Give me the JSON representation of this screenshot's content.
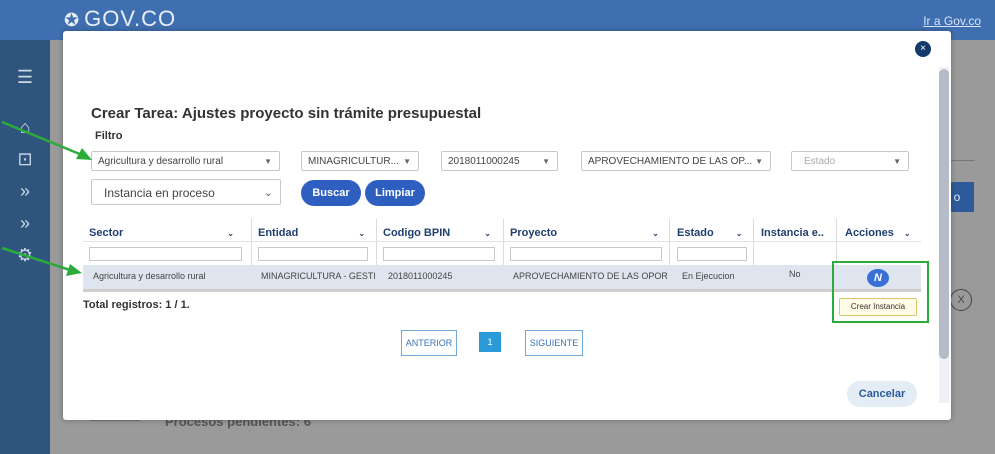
{
  "header": {
    "logo_text": "GOV.CO",
    "logo_mark": "✪",
    "link": "Ir a Gov.co"
  },
  "background": {
    "pending_text": "Procesos pendientes: 6",
    "side_button": "o",
    "x_icon": "X"
  },
  "rail": {
    "icons": [
      "menu-icon",
      "home-icon",
      "chat-icon",
      "forward-icon",
      "forward-icon",
      "settings-icon"
    ]
  },
  "modal": {
    "close": "×",
    "title": "Crear Tarea: Ajustes proyecto sin trámite presupuestal",
    "filter_label": "Filtro",
    "filters": {
      "sector": "Agricultura y desarrollo rural",
      "entidad": "MINAGRICULTUR...",
      "bpin": "2018011000245",
      "proyecto": "APROVECHAMIENTO DE LAS OP...",
      "estado_placeholder": "Estado",
      "instancia": "Instancia en proceso"
    },
    "buttons": {
      "search": "Buscar",
      "clear": "Limpiar"
    },
    "columns": [
      "Sector",
      "Entidad",
      "Codigo BPIN",
      "Proyecto",
      "Estado",
      "Instancia e..",
      "Acciones"
    ],
    "rows": [
      {
        "sector": "Agricultura y desarrollo rural",
        "entidad": "MINAGRICULTURA - GESTIC",
        "bpin": "2018011000245",
        "proyecto": "APROVECHAMIENTO DE LAS OPORTU",
        "estado": "En Ejecucion",
        "instancia": "No"
      }
    ],
    "action_icon_text": "N",
    "tooltip": "Crear Instancia",
    "total": "Total registros: 1 / 1.",
    "pagination": {
      "prev": "ANTERIOR",
      "page": "1",
      "next": "SIGUIENTE"
    },
    "cancel": "Cancelar"
  },
  "colors": {
    "primary": "#2e5fc0",
    "highlight": "#2cab3a",
    "arrow": "#2cab3a",
    "row_bg": "#dfe5ee"
  }
}
